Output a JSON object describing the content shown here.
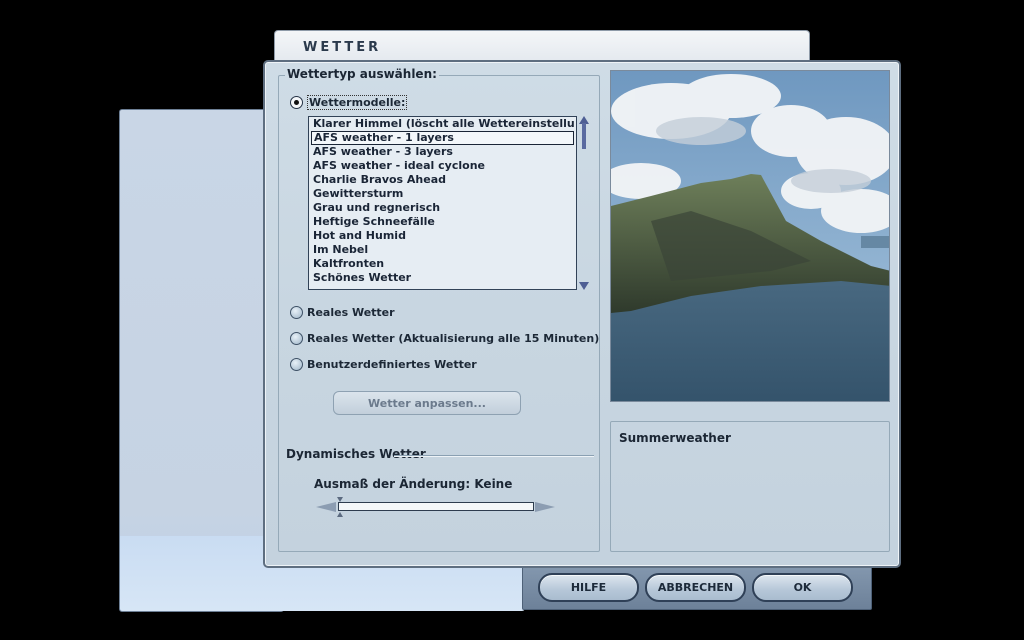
{
  "dialog": {
    "title": "WETTER",
    "group_label": "Wettertyp auswählen:"
  },
  "options": {
    "wettermodelle": "Wettermodelle:",
    "reales_wetter": "Reales Wetter",
    "reales_wetter_update": "Reales Wetter (Aktualisierung alle 15 Minuten)",
    "benutzer": "Benutzerdefiniertes Wetter",
    "selected": "wettermodelle"
  },
  "weather_list": {
    "items": [
      "Klarer Himmel (löscht alle Wettereinstellungen)",
      "AFS weather - 1 layers",
      "AFS weather - 3 layers",
      "AFS weather - ideal cyclone",
      "Charlie Bravos Ahead",
      "Gewittersturm",
      "Grau und regnerisch",
      "Heftige Schneefälle",
      "Hot and Humid",
      "Im Nebel",
      "Kaltfronten",
      "Schönes Wetter"
    ],
    "selected_index": 1
  },
  "customize_button": "Wetter anpassen...",
  "dynamic": {
    "title": "Dynamisches Wetter",
    "change_label": "Ausmaß der Änderung: Keine",
    "level": 0
  },
  "description": {
    "title": "Summerweather"
  },
  "buttons": {
    "help": "HILFE",
    "cancel": "ABBRECHEN",
    "ok": "OK"
  },
  "colors": {
    "dialog_bg": "#cfdce6",
    "border": "#5e6e80",
    "text": "#1b2634",
    "sky": "#8fb3d3",
    "water": "#3d5d74"
  }
}
